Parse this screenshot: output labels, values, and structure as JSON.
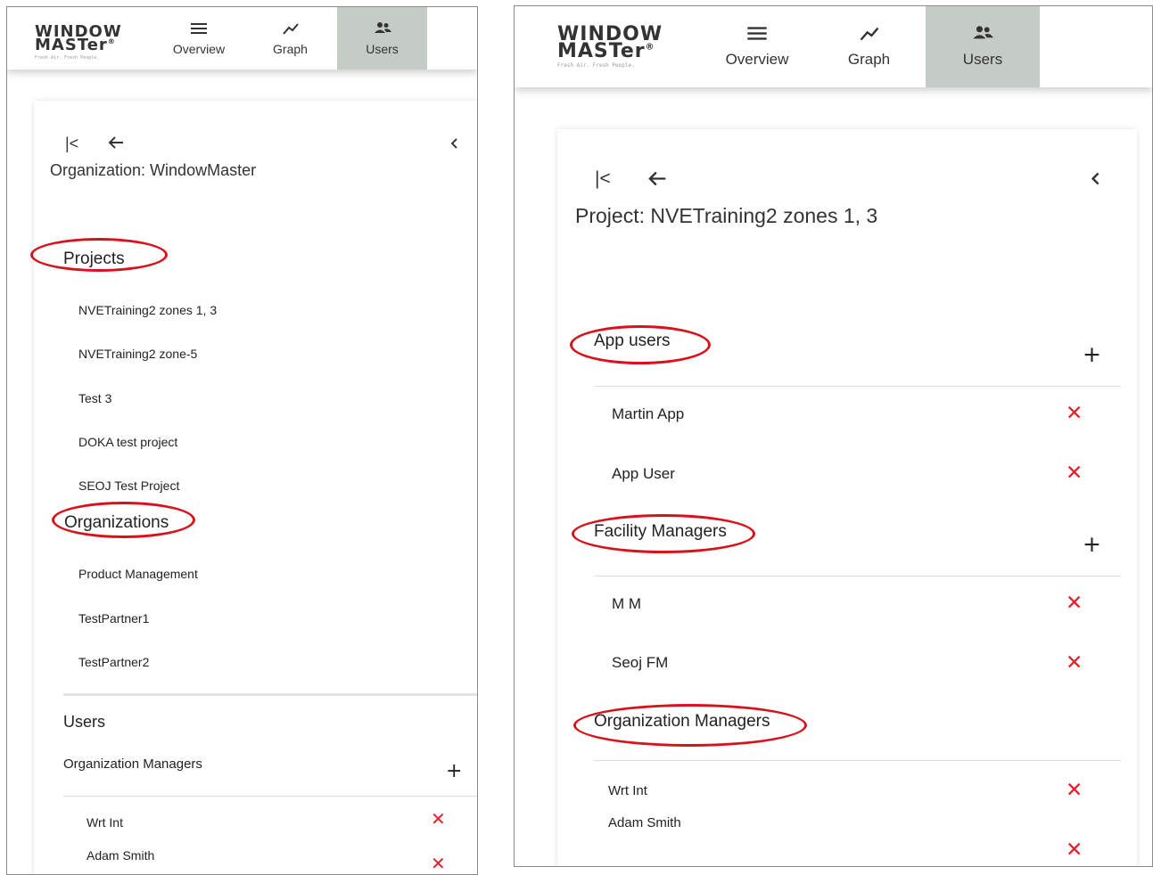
{
  "brand": {
    "name": "WINDOW",
    "name2": "MASTer",
    "reg": "®",
    "tagline": "Fresh Air. Fresh People."
  },
  "nav": {
    "overview_label": "Overview",
    "graph_label": "Graph",
    "users_label": "Users",
    "active": "Users"
  },
  "left_panel": {
    "title": "Organization: WindowMaster",
    "projects_heading": "Projects",
    "projects": [
      "NVETraining2 zones 1, 3",
      "NVETraining2 zone-5",
      "Test 3",
      "DOKA test project",
      "SEOJ Test Project"
    ],
    "organizations_heading": "Organizations",
    "organizations": [
      "Product Management",
      "TestPartner1",
      "TestPartner2"
    ],
    "users_heading": "Users",
    "org_managers_heading": "Organization Managers",
    "org_managers": [
      "Wrt Int",
      "Adam Smith"
    ]
  },
  "right_panel": {
    "title": "Project: NVETraining2 zones 1, 3",
    "app_users_heading": "App users",
    "app_users": [
      "Martin App",
      "App User"
    ],
    "facility_managers_heading": "Facility Managers",
    "facility_managers": [
      "M M",
      "Seoj FM"
    ],
    "org_managers_heading": "Organization Managers",
    "org_managers": [
      "Wrt Int",
      "Adam Smith"
    ]
  },
  "icons": {
    "first_page": "first-page-icon",
    "back": "arrow-back-icon",
    "collapse": "chevron-left-icon",
    "add": "plus-icon",
    "remove": "close-icon",
    "menu": "hamburger-icon",
    "graph": "trend-line-icon",
    "users": "people-icon"
  },
  "colors": {
    "accent_active_tab": "#c5ccc5",
    "remove_red": "#e3202a",
    "annotation_red": "#d8121b"
  }
}
